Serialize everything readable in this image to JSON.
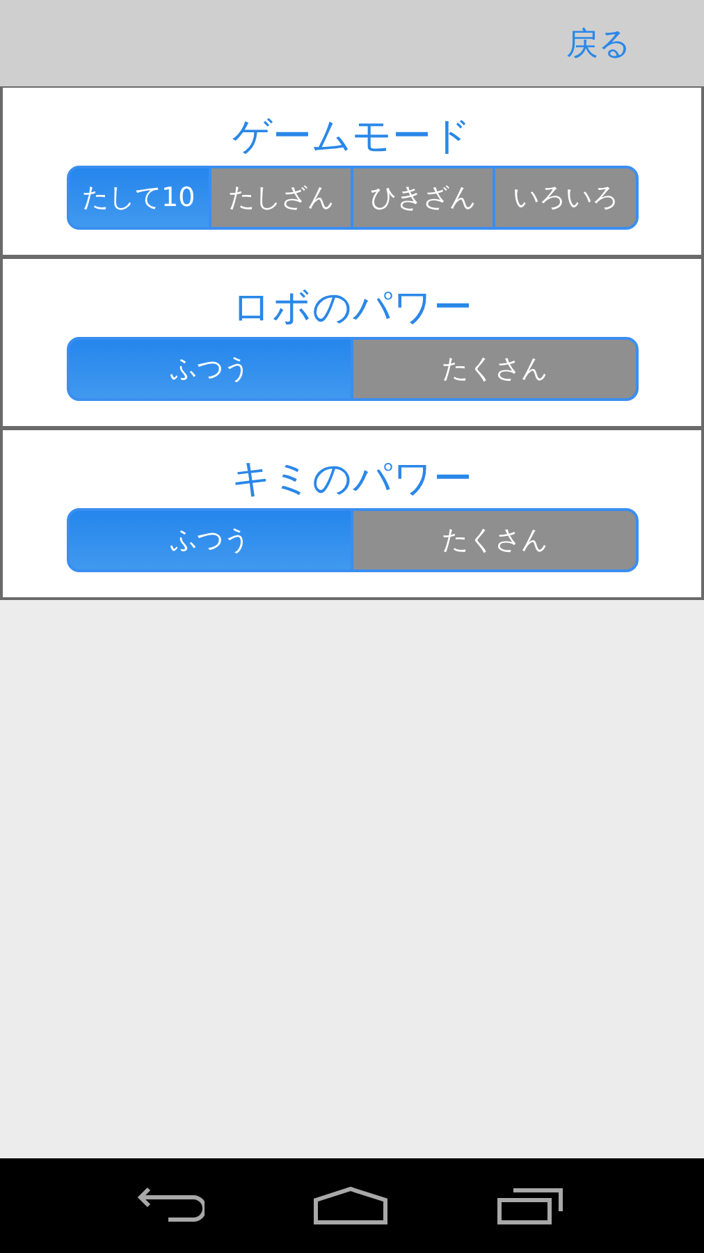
{
  "header": {
    "back_button": "戻る"
  },
  "sections": [
    {
      "title": "ゲームモード",
      "options": [
        {
          "label": "たして10",
          "selected": true
        },
        {
          "label": "たしざん",
          "selected": false
        },
        {
          "label": "ひきざん",
          "selected": false
        },
        {
          "label": "いろいろ",
          "selected": false
        }
      ]
    },
    {
      "title": "ロボのパワー",
      "options": [
        {
          "label": "ふつう",
          "selected": true
        },
        {
          "label": "たくさん",
          "selected": false
        }
      ]
    },
    {
      "title": "キミのパワー",
      "options": [
        {
          "label": "ふつう",
          "selected": true
        },
        {
          "label": "たくさん",
          "selected": false
        }
      ]
    }
  ]
}
